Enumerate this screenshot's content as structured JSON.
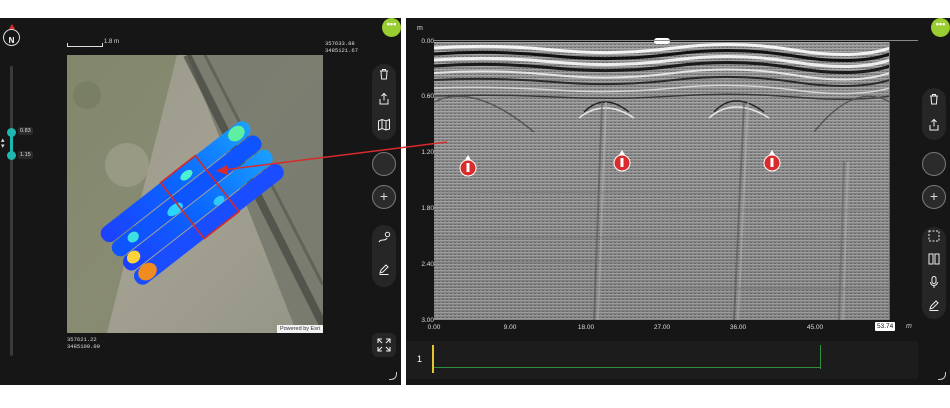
{
  "map": {
    "north_label": "N",
    "scale_label": "1.8 m",
    "coord_top_right": [
      "357633.88",
      "3485121.67"
    ],
    "coord_bottom_left": [
      "357621.22",
      "3485109.00"
    ],
    "attribution": "Powered by Esri",
    "slider_top_value": "0.83",
    "slider_bottom_value": "1.15"
  },
  "radargram": {
    "depth_unit": "m",
    "depth_ticks": [
      "0.00",
      "0.60",
      "1.20",
      "1.80",
      "2.40",
      "3.00"
    ],
    "distance_ticks": [
      "0.00",
      "9.00",
      "18.00",
      "27.00",
      "36.00",
      "45.00"
    ],
    "current_distance": "53.74",
    "distance_unit": "m",
    "hyperbola_markers": 3
  },
  "channel": {
    "number": "1"
  },
  "colors": {
    "panel_bg": "#161616",
    "accent_green": "#9acd32",
    "marker_red": "#d92b2b",
    "scan_line_green": "#2f8f3a"
  },
  "icons": {
    "left_toolbar": [
      "trash-icon",
      "share-icon",
      "map-icon"
    ],
    "left_lower_toolbar": [
      "route-add-icon",
      "pen-icon"
    ],
    "right_toolbar": [
      "trash-icon",
      "share-icon"
    ],
    "right_lower_toolbar": [
      "selection-icon",
      "split-view-icon",
      "microphone-icon",
      "pen-icon"
    ]
  }
}
